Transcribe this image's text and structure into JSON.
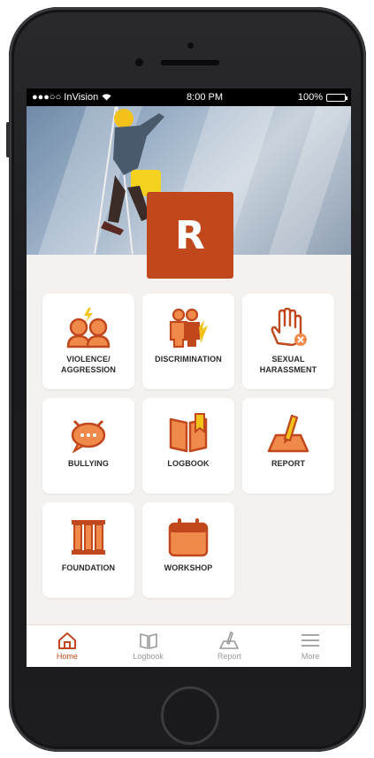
{
  "status_bar": {
    "carrier": "●●●○○ InVision",
    "time": "8:00 PM",
    "battery": "100%"
  },
  "logo": {
    "letter": "R"
  },
  "tiles": [
    {
      "label": "VIOLENCE/\nAGGRESSION",
      "icon": "violence-aggression-icon"
    },
    {
      "label": "DISCRIMINATION",
      "icon": "discrimination-icon"
    },
    {
      "label": "SEXUAL\nHARASSMENT",
      "icon": "sexual-harassment-icon"
    },
    {
      "label": "BULLYING",
      "icon": "bullying-icon"
    },
    {
      "label": "LOGBOOK",
      "icon": "logbook-icon"
    },
    {
      "label": "REPORT",
      "icon": "report-icon"
    },
    {
      "label": "FOUNDATION",
      "icon": "foundation-icon"
    },
    {
      "label": "WORKSHOP",
      "icon": "workshop-icon"
    }
  ],
  "tabbar": {
    "items": [
      {
        "label": "Home",
        "icon": "home-icon",
        "active": true
      },
      {
        "label": "Logbook",
        "icon": "logbook-icon",
        "active": false
      },
      {
        "label": "Report",
        "icon": "report-icon",
        "active": false
      },
      {
        "label": "More",
        "icon": "menu-icon",
        "active": false
      }
    ]
  },
  "colors": {
    "accent": "#c0481c",
    "icon_light": "#f08a4b",
    "background": "#f4f1ee"
  }
}
